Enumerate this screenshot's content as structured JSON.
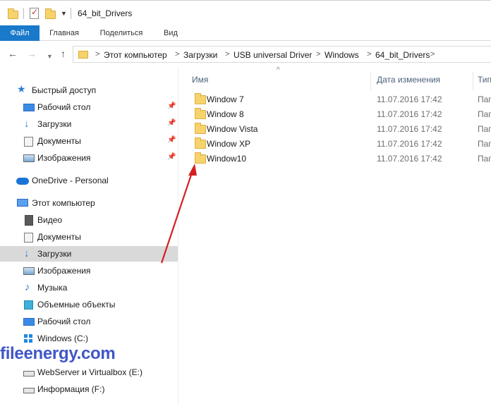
{
  "window": {
    "title": "64_bit_Drivers"
  },
  "ribbon": {
    "tabs": [
      "Файл",
      "Главная",
      "Поделиться",
      "Вид"
    ]
  },
  "address": {
    "breadcrumbs": [
      "Этот компьютер",
      "Загрузки",
      "USB universal Driver",
      "Windows",
      "64_bit_Drivers"
    ]
  },
  "nav": {
    "quick_access": "Быстрый доступ",
    "quick_items": [
      {
        "label": "Рабочий стол",
        "icon": "desktop-icon",
        "pinned": true
      },
      {
        "label": "Загрузки",
        "icon": "downloads-icon",
        "pinned": true
      },
      {
        "label": "Документы",
        "icon": "documents-icon",
        "pinned": true
      },
      {
        "label": "Изображения",
        "icon": "pictures-icon",
        "pinned": true
      }
    ],
    "onedrive": "OneDrive - Personal",
    "this_pc": "Этот компьютер",
    "pc_items": [
      {
        "label": "Видео",
        "icon": "video-icon"
      },
      {
        "label": "Документы",
        "icon": "documents-icon"
      },
      {
        "label": "Загрузки",
        "icon": "downloads-icon",
        "selected": true
      },
      {
        "label": "Изображения",
        "icon": "pictures-icon"
      },
      {
        "label": "Музыка",
        "icon": "music-icon"
      },
      {
        "label": "Объемные объекты",
        "icon": "3d-objects-icon"
      },
      {
        "label": "Рабочий стол",
        "icon": "desktop-icon"
      },
      {
        "label": "Windows (C:)",
        "icon": "windows-drive-icon"
      },
      {
        "label": "WebServer и Virtualbox (E:)",
        "icon": "drive-icon"
      },
      {
        "label": "Информация (F:)",
        "icon": "drive-icon"
      }
    ]
  },
  "columns": {
    "name": "Имя",
    "date": "Дата изменения",
    "type": "Тип"
  },
  "files": [
    {
      "name": "Window 7",
      "date": "11.07.2016 17:42",
      "type": "Пап"
    },
    {
      "name": "Window 8",
      "date": "11.07.2016 17:42",
      "type": "Пап"
    },
    {
      "name": "Window Vista",
      "date": "11.07.2016 17:42",
      "type": "Пап"
    },
    {
      "name": "Window XP",
      "date": "11.07.2016 17:42",
      "type": "Пап"
    },
    {
      "name": "Window10",
      "date": "11.07.2016 17:42",
      "type": "Пап"
    }
  ],
  "watermark": "fileenergy.com",
  "colors": {
    "accent": "#1979ca",
    "selection": "#d9d9d9",
    "folder": "#f7d36b",
    "annotation_arrow": "#d42020",
    "watermark": "#3048c2"
  }
}
